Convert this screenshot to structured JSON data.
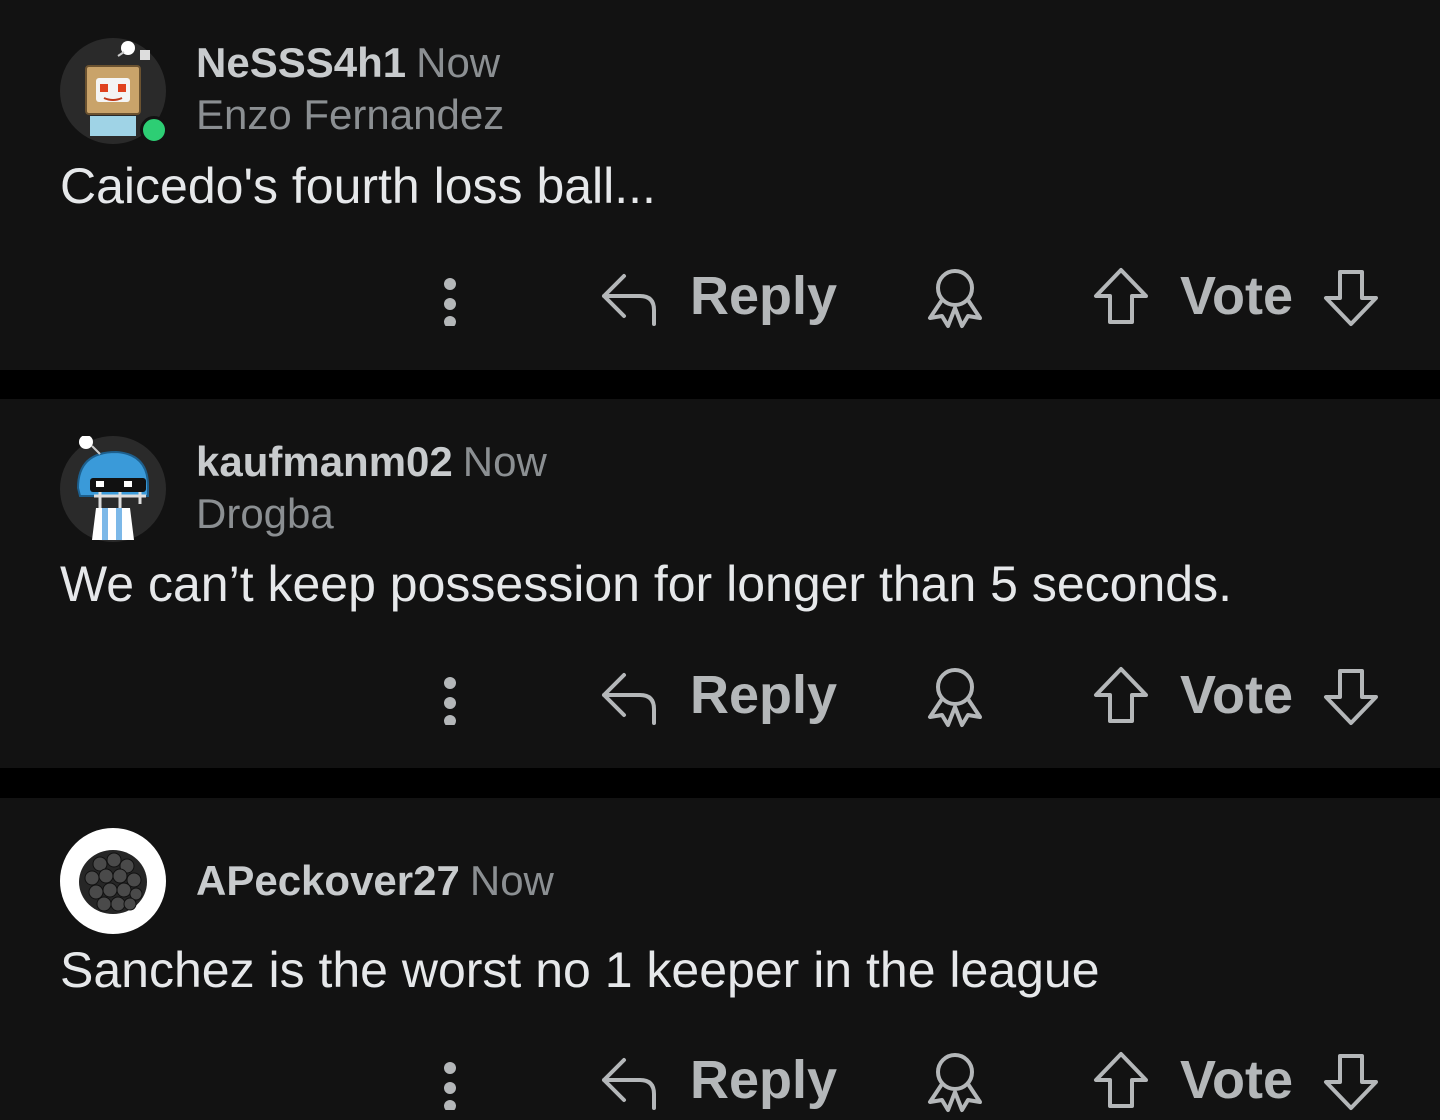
{
  "comments": [
    {
      "username": "NeSSS4h1",
      "time": "Now",
      "flair": "Enzo Fernandez",
      "body": "Caicedo's fourth loss ball...",
      "online": true,
      "avatar_icon": "robot-box-avatar-icon",
      "reply_label": "Reply",
      "vote_label": "Vote"
    },
    {
      "username": "kaufmanm02",
      "time": "Now",
      "flair": "Drogba",
      "body": "We can’t keep possession for longer than 5 seconds.",
      "online": false,
      "avatar_icon": "football-helmet-avatar-icon",
      "reply_label": "Reply",
      "vote_label": "Vote"
    },
    {
      "username": "APeckover27",
      "time": "Now",
      "flair": "",
      "body": "Sanchez is the worst no 1 keeper in the league",
      "online": false,
      "avatar_icon": "blackberry-avatar-icon",
      "reply_label": "Reply",
      "vote_label": "Vote"
    }
  ],
  "colors": {
    "background": "#000000",
    "card": "#121212",
    "text_primary": "#e6e8ea",
    "text_secondary": "#8b8f92",
    "online": "#2dce74"
  },
  "icons": [
    "more-vertical-icon",
    "reply-arrow-icon",
    "award-icon",
    "upvote-arrow-icon",
    "downvote-arrow-icon"
  ]
}
